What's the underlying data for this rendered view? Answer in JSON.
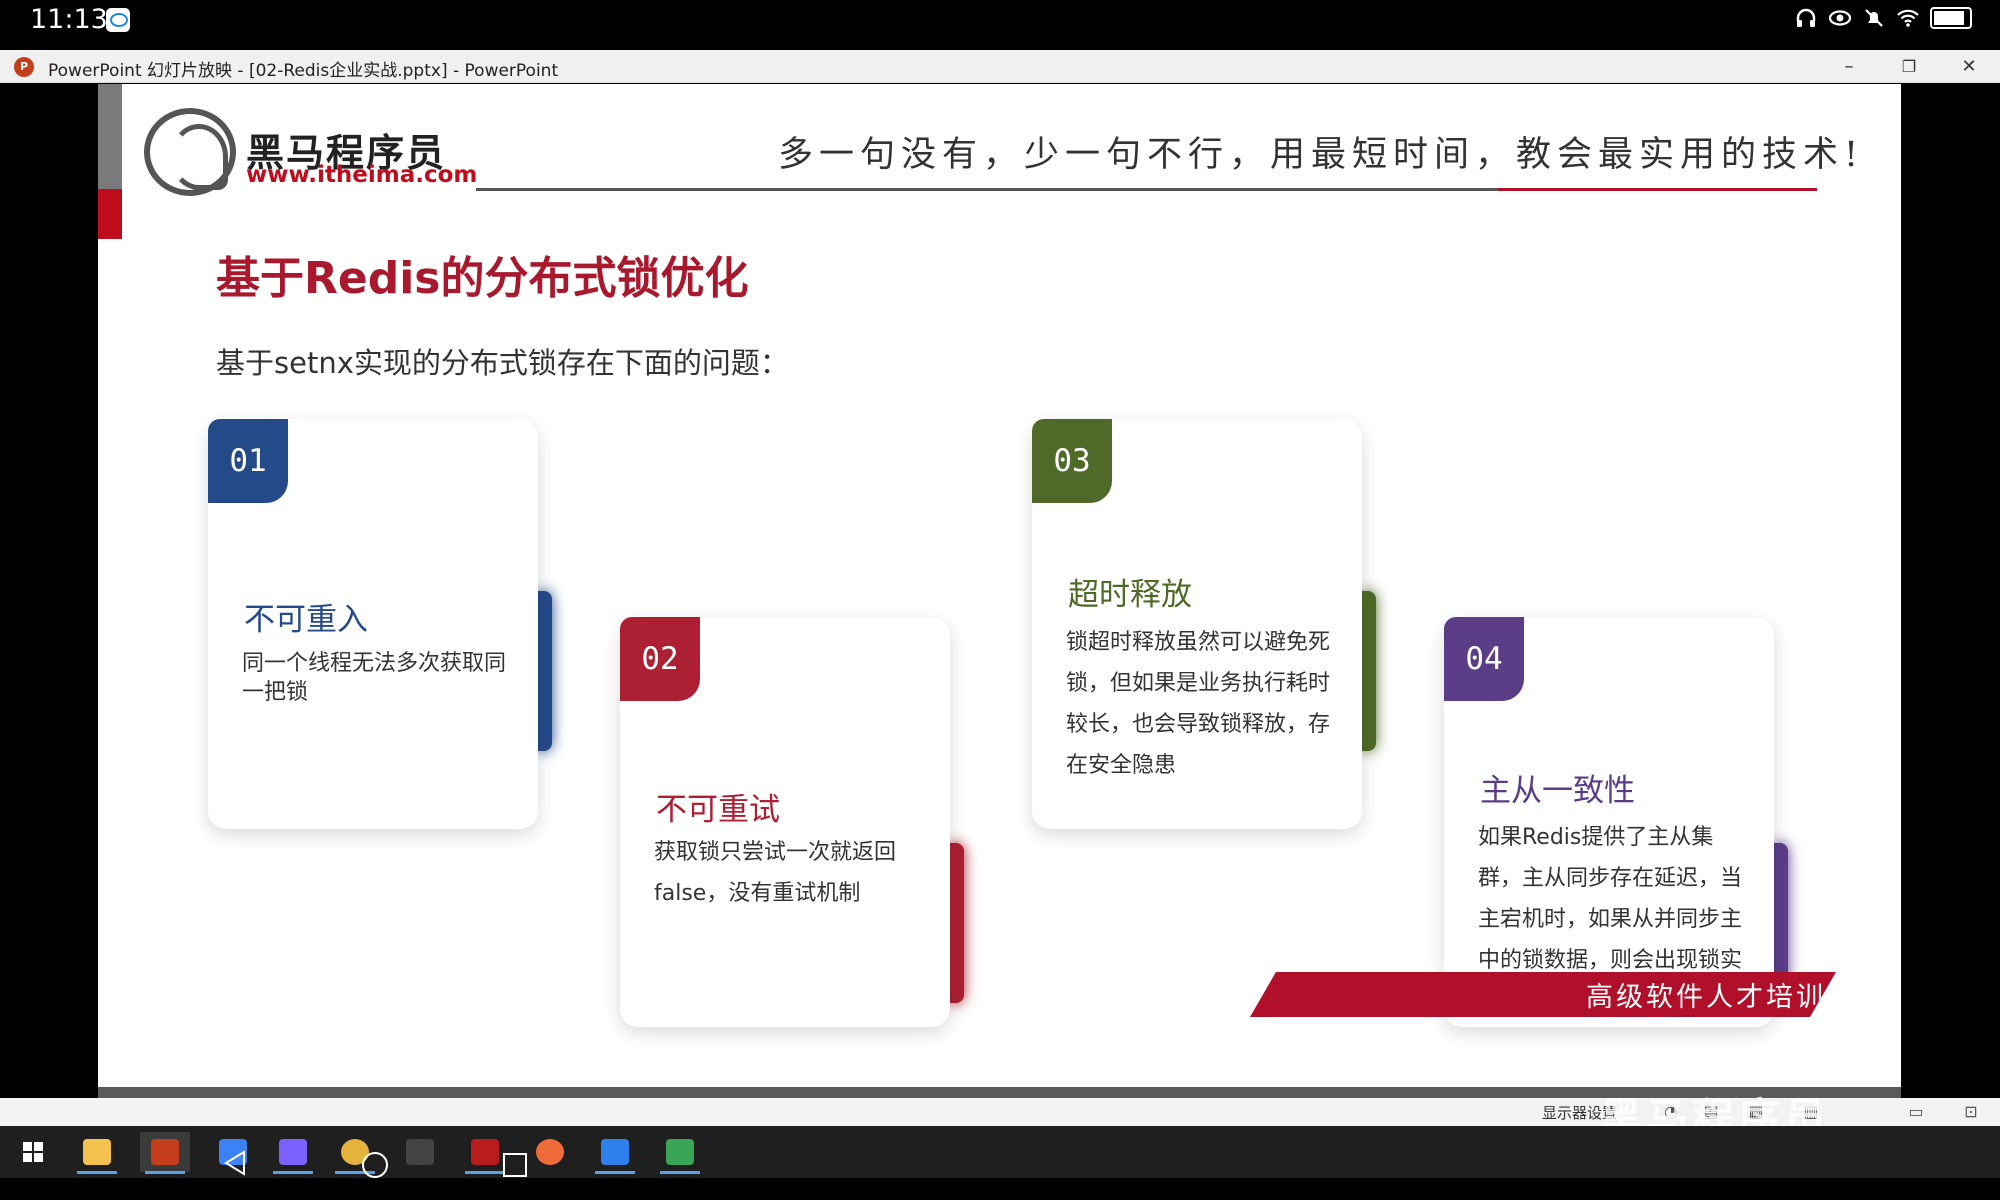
{
  "status_bar": {
    "time": "11:13",
    "icons": [
      "notification-app-icon",
      "headphones-icon",
      "eye-comfort-icon",
      "mute-icon",
      "wifi-icon",
      "battery-icon"
    ]
  },
  "window": {
    "title": "PowerPoint 幻灯片放映 - [02-Redis企业实战.pptx] - PowerPoint",
    "minimize": "–",
    "restore": "❐",
    "close": "✕"
  },
  "slide": {
    "logo_name": "黑马程序员",
    "logo_url": "www.itheima.com",
    "slogan": "多一句没有，少一句不行，用最短时间，教会最实用的技术!",
    "title": "基于Redis的分布式锁优化",
    "subtitle": "基于setnx实现的分布式锁存在下面的问题：",
    "cards": [
      {
        "num": "01",
        "title": "不可重入",
        "text": "同一个线程无法多次获取同一把锁",
        "color": "#254a8a"
      },
      {
        "num": "02",
        "title": "不可重试",
        "text": "获取锁只尝试一次就返回false，没有重试机制",
        "color": "#ad1f33"
      },
      {
        "num": "03",
        "title": "超时释放",
        "text": "锁超时释放虽然可以避免死锁，但如果是业务执行耗时较长，也会导致锁释放，存在安全隐患",
        "color": "#4f6a28"
      },
      {
        "num": "04",
        "title": "主从一致性",
        "text": "如果Redis提供了主从集群，主从同步存在延迟，当主宕机时，如果从并同步主中的锁数据，则会出现锁实现",
        "color": "#5b3d87"
      }
    ],
    "band_text": "高级软件人才培训专家"
  },
  "slideshow_bar": {
    "display_settings": "显示器设置"
  },
  "watermark": "黑马程序员",
  "taskbar": {
    "apps": [
      "start-icon",
      "file-explorer-icon",
      "powerpoint-icon",
      "paint-icon",
      "intellij-icon",
      "chrome-icon",
      "terminal-icon",
      "redis-desktop-icon",
      "postman-icon",
      "vscode-icon",
      "snipaste-icon"
    ],
    "colors": [
      "#ffffff",
      "#f2c14e",
      "#c43e1c",
      "#3b82f6",
      "#7b61ff",
      "#e5b33b",
      "#444444",
      "#b91c1c",
      "#ef6c3a",
      "#2f80ed",
      "#3aa655"
    ]
  }
}
